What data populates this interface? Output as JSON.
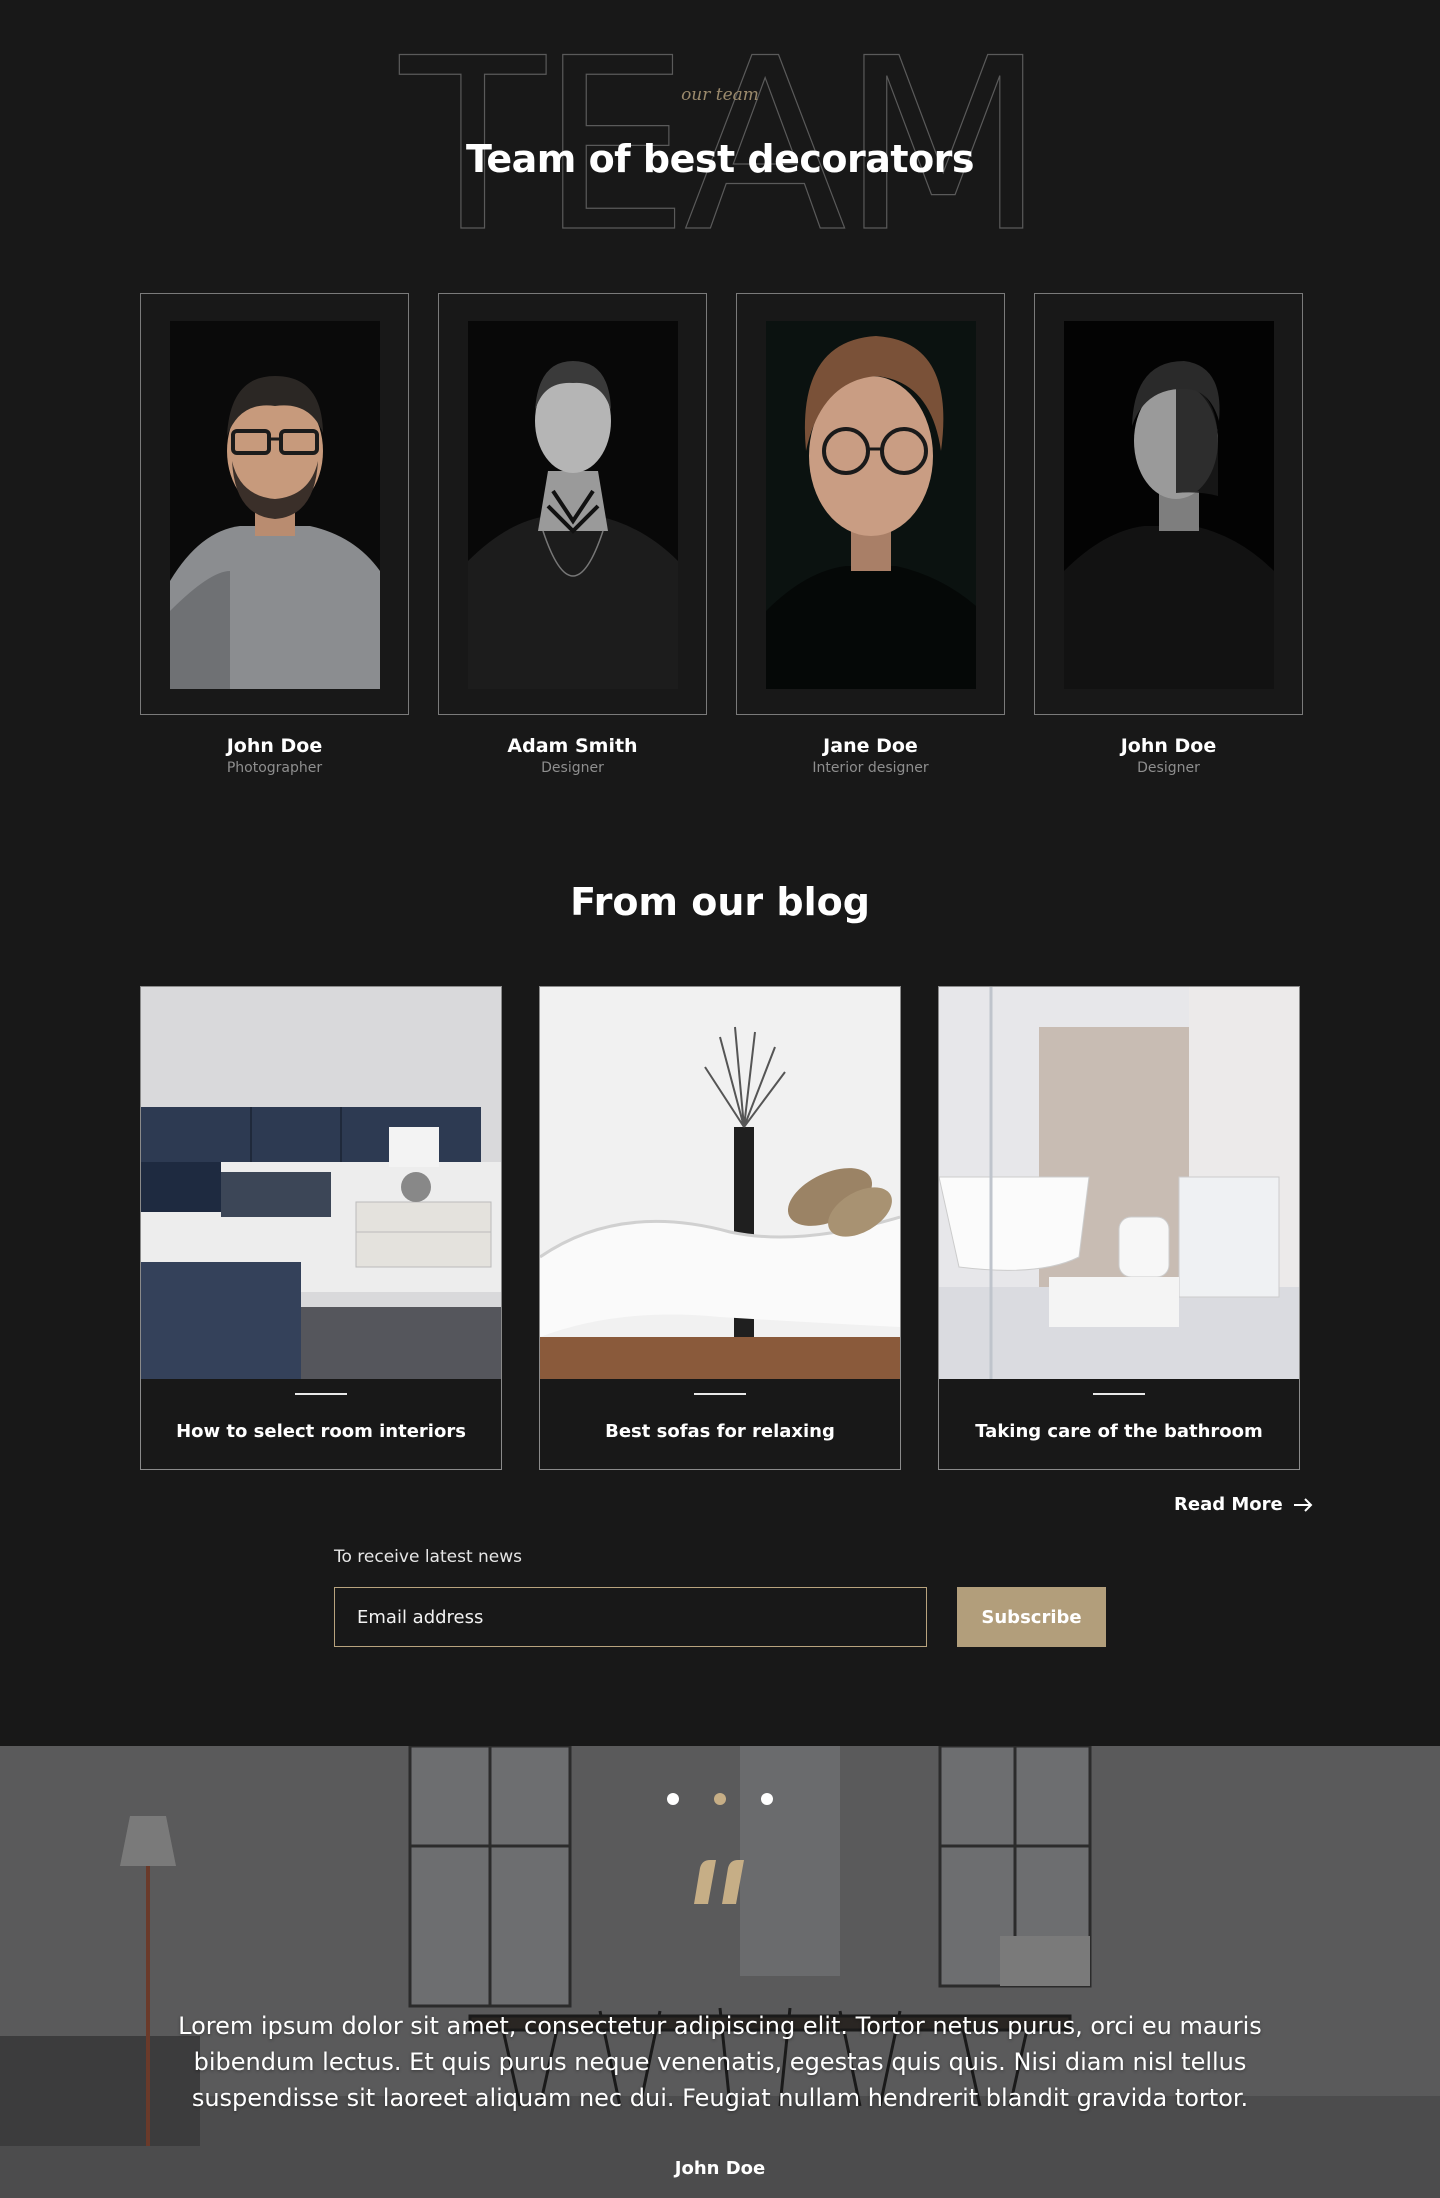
{
  "team": {
    "watermark": "TEAM",
    "eyebrow": "our team",
    "title": "Team of best decorators",
    "members": [
      {
        "name": "John Doe",
        "role": "Photographer"
      },
      {
        "name": "Adam Smith",
        "role": "Designer"
      },
      {
        "name": "Jane Doe",
        "role": "Interior designer"
      },
      {
        "name": "John Doe",
        "role": "Designer"
      }
    ]
  },
  "blog": {
    "title": "From our blog",
    "posts": [
      {
        "title": "How to select room interiors"
      },
      {
        "title": "Best sofas for relaxing"
      },
      {
        "title": "Taking care of the bathroom"
      }
    ],
    "read_more": "Read More"
  },
  "newsletter": {
    "label": "To receive latest news",
    "email_placeholder": "Email address",
    "subscribe_label": "Subscribe"
  },
  "testimonial": {
    "active_slide": 2,
    "slide_count": 3,
    "quote": "Lorem ipsum dolor sit amet, consectetur adipiscing elit. Tortor netus purus, orci eu mauris bibendum lectus. Et quis purus neque venenatis, egestas quis quis. Nisi diam nisl tellus suspendisse sit laoreet aliquam nec dui. Feugiat nullam hendrerit blandit gravida tortor.",
    "author": "John Doe"
  },
  "colors": {
    "background": "#181818",
    "accent": "#b29e7b",
    "text": "#ffffff",
    "muted": "#8e8e8e"
  }
}
